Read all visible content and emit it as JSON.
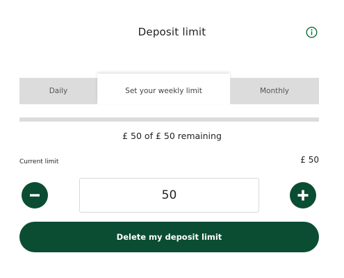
{
  "header": {
    "title": "Deposit limit",
    "info_icon": "info-icon"
  },
  "tabs": [
    {
      "label": "Daily",
      "active": false
    },
    {
      "label": "Set your weekly limit",
      "active": true
    },
    {
      "label": "Monthly",
      "active": false
    }
  ],
  "progress": {
    "fraction_used": 0
  },
  "remaining_text": "£ 50 of £ 50 remaining",
  "current_limit": {
    "label": "Current limit",
    "value": "£ 50"
  },
  "amount": {
    "value": "50"
  },
  "controls": {
    "minus_icon": "minus-icon",
    "plus_icon": "plus-icon"
  },
  "delete_button_label": "Delete my deposit limit",
  "colors": {
    "brand": "#0b4d32",
    "tab_inactive": "#dcdcdc",
    "progress_track": "#dcdcdc"
  }
}
